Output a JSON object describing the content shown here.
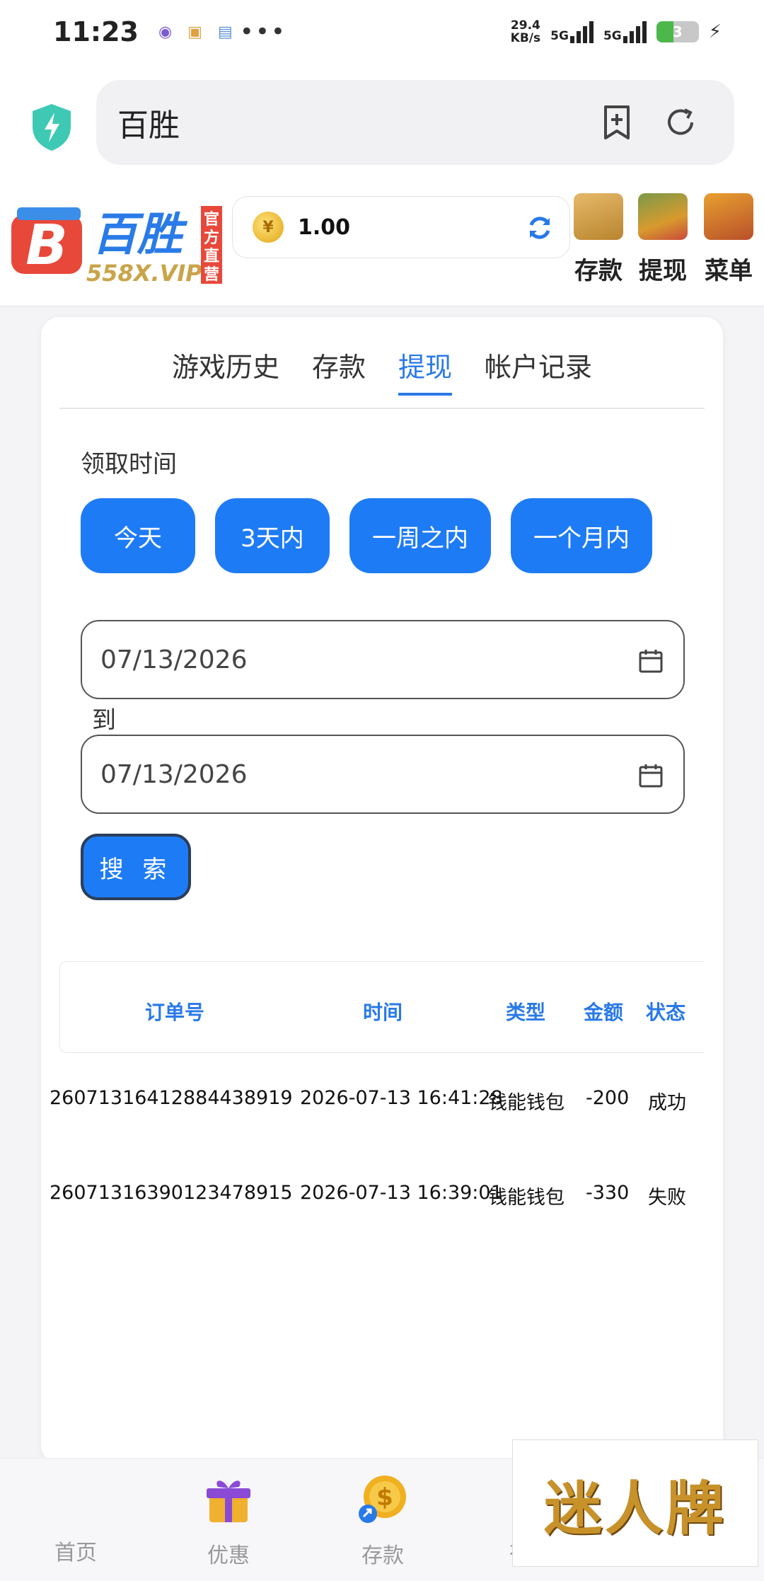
{
  "status": {
    "time": "11:23",
    "netspeed": "29.4",
    "netspeed_unit": "KB/s",
    "net1": "5G",
    "net2": "5G",
    "battery": "3"
  },
  "browser": {
    "url": "百胜"
  },
  "site": {
    "logo_main": "百胜",
    "logo_sub": "558X.VIP",
    "logo_badge": "官方直营",
    "balance": "1.00",
    "coin_symbol": "¥",
    "buttons": {
      "deposit": "存款",
      "withdraw": "提现",
      "menu": "菜单"
    }
  },
  "tabs": [
    "游戏历史",
    "存款",
    "提现",
    "帐户记录"
  ],
  "active_tab": "提现",
  "filter": {
    "label": "领取时间",
    "chips": [
      "今天",
      "3天内",
      "一周之内",
      "一个月内"
    ],
    "date_from": "07/13/2026",
    "to_label": "到",
    "date_to": "07/13/2026",
    "search_label": "搜 索"
  },
  "table": {
    "headers": [
      "订单号",
      "时间",
      "类型",
      "金额",
      "状态"
    ],
    "rows": [
      [
        "26071316412884438919",
        "2026-07-13 16:41:28",
        "钱能钱包",
        "-200",
        "成功"
      ],
      [
        "26071316390123478915",
        "2026-07-13 16:39:01",
        "钱能钱包",
        "-330",
        "失败"
      ]
    ]
  },
  "bottom_nav": [
    "首页",
    "优惠",
    "存款",
    "在"
  ],
  "ad": {
    "text": "迷人牌"
  },
  "colors": {
    "primary": "#1e7bf6",
    "accent_text": "#2979e8",
    "success": "#4cb84c"
  }
}
